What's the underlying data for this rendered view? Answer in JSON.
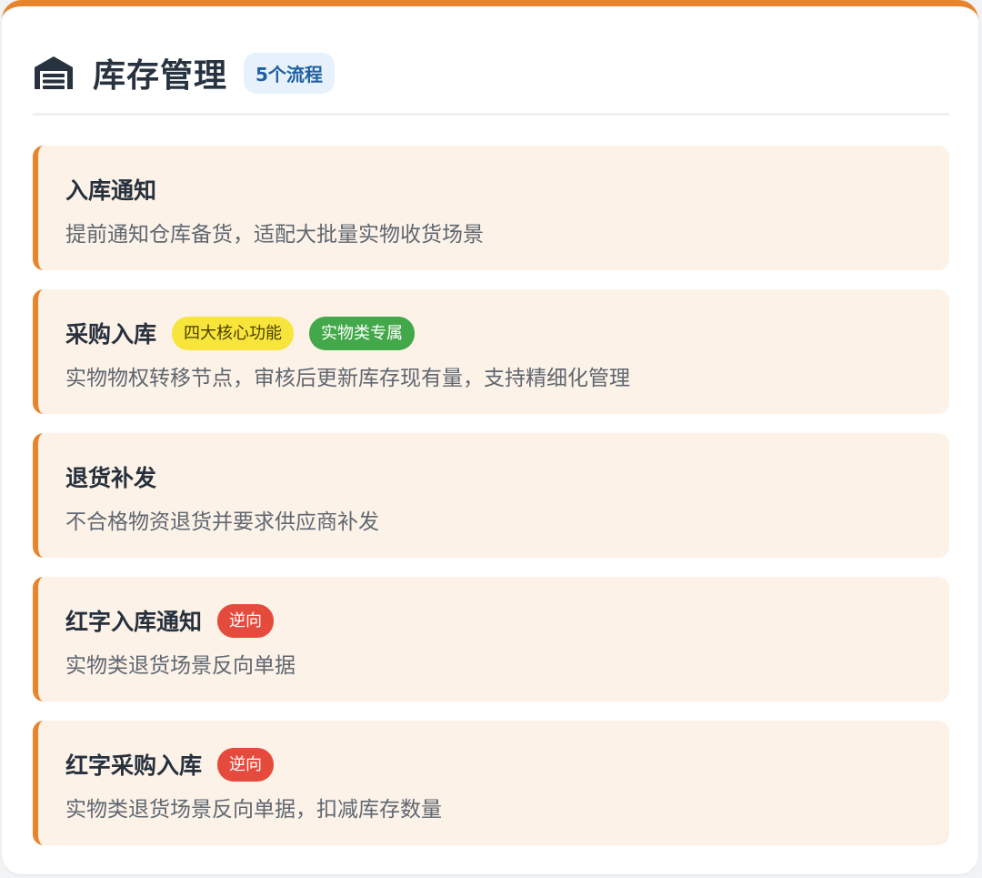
{
  "header": {
    "icon": "warehouse-icon",
    "title": "库存管理",
    "badge": "5个流程"
  },
  "colors": {
    "accent": "#e8842c",
    "card_bg": "#fdf2e8",
    "badge_bg": "#e6f1fc",
    "badge_text": "#1f5f9f",
    "tag_yellow": "#f8e53c",
    "tag_green": "#43a84a",
    "tag_red": "#e54b3c"
  },
  "flows": [
    {
      "title": "入库通知",
      "tags": [],
      "description": "提前通知仓库备货，适配大批量实物收货场景"
    },
    {
      "title": "采购入库",
      "tags": [
        {
          "label": "四大核心功能",
          "color": "yellow"
        },
        {
          "label": "实物类专属",
          "color": "green"
        }
      ],
      "description": "实物物权转移节点，审核后更新库存现有量，支持精细化管理"
    },
    {
      "title": "退货补发",
      "tags": [],
      "description": "不合格物资退货并要求供应商补发"
    },
    {
      "title": "红字入库通知",
      "tags": [
        {
          "label": "逆向",
          "color": "red"
        }
      ],
      "description": "实物类退货场景反向单据"
    },
    {
      "title": "红字采购入库",
      "tags": [
        {
          "label": "逆向",
          "color": "red"
        }
      ],
      "description": "实物类退货场景反向单据，扣减库存数量"
    }
  ]
}
